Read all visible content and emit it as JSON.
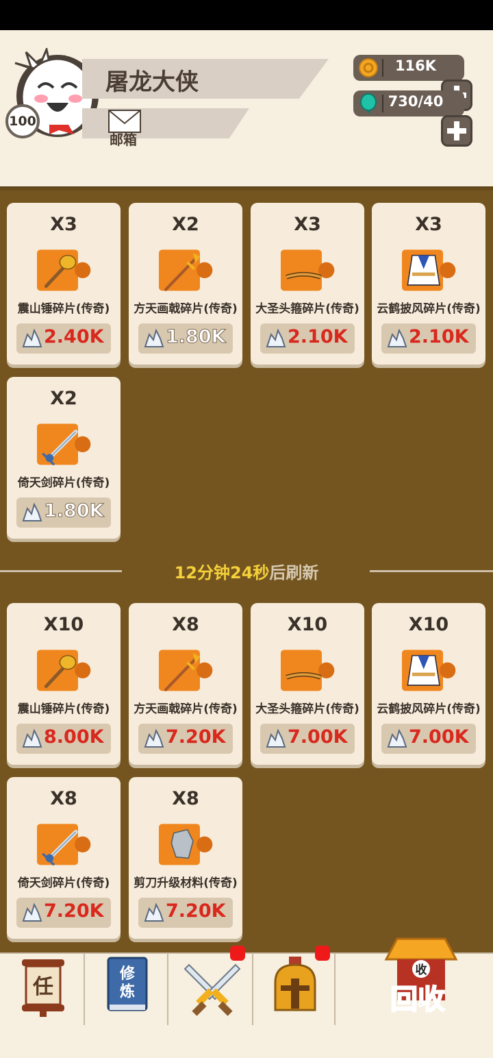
{
  "player": {
    "name": "屠龙大侠",
    "level": "100",
    "mail_label": "邮箱"
  },
  "resources": {
    "gold": "116K",
    "gems": "730/40"
  },
  "refresh": {
    "time": "12分钟24秒",
    "suffix": "后刷新"
  },
  "shop_top": [
    {
      "qty": "X3",
      "name": "震山锤碎片(传奇)",
      "price": "2.40K",
      "price_color": "red",
      "icon": "hammer-icon"
    },
    {
      "qty": "X2",
      "name": "方天画戟碎片(传奇)",
      "price": "1.80K",
      "price_color": "white",
      "icon": "halberd-icon"
    },
    {
      "qty": "X3",
      "name": "大圣头箍碎片(传奇)",
      "price": "2.10K",
      "price_color": "red",
      "icon": "headband-icon"
    },
    {
      "qty": "X3",
      "name": "云鹤披风碎片(传奇)",
      "price": "2.10K",
      "price_color": "red",
      "icon": "cloak-icon"
    },
    {
      "qty": "X2",
      "name": "倚天剑碎片(传奇)",
      "price": "1.80K",
      "price_color": "white",
      "icon": "sword-icon"
    }
  ],
  "shop_bottom": [
    {
      "qty": "X10",
      "name": "震山锤碎片(传奇)",
      "price": "8.00K",
      "price_color": "red",
      "icon": "hammer-icon"
    },
    {
      "qty": "X8",
      "name": "方天画戟碎片(传奇)",
      "price": "7.20K",
      "price_color": "red",
      "icon": "halberd-icon"
    },
    {
      "qty": "X10",
      "name": "大圣头箍碎片(传奇)",
      "price": "7.00K",
      "price_color": "red",
      "icon": "headband-icon"
    },
    {
      "qty": "X10",
      "name": "云鹤披风碎片(传奇)",
      "price": "7.00K",
      "price_color": "red",
      "icon": "cloak-icon"
    },
    {
      "qty": "X8",
      "name": "倚天剑碎片(传奇)",
      "price": "7.20K",
      "price_color": "red",
      "icon": "sword-icon"
    },
    {
      "qty": "X8",
      "name": "剪刀升级材料(传奇)",
      "price": "7.20K",
      "price_color": "red",
      "icon": "stone-icon"
    }
  ],
  "nav": {
    "task_glyph": "任",
    "cultivate_glyph_1": "修",
    "cultivate_glyph_2": "炼",
    "recycle_sign": "收",
    "recycle_label": "回收"
  },
  "colors": {
    "background": "#745520",
    "card": "#f7ecdc",
    "price_red": "#d9281d",
    "badge": "#ee1a1a"
  }
}
